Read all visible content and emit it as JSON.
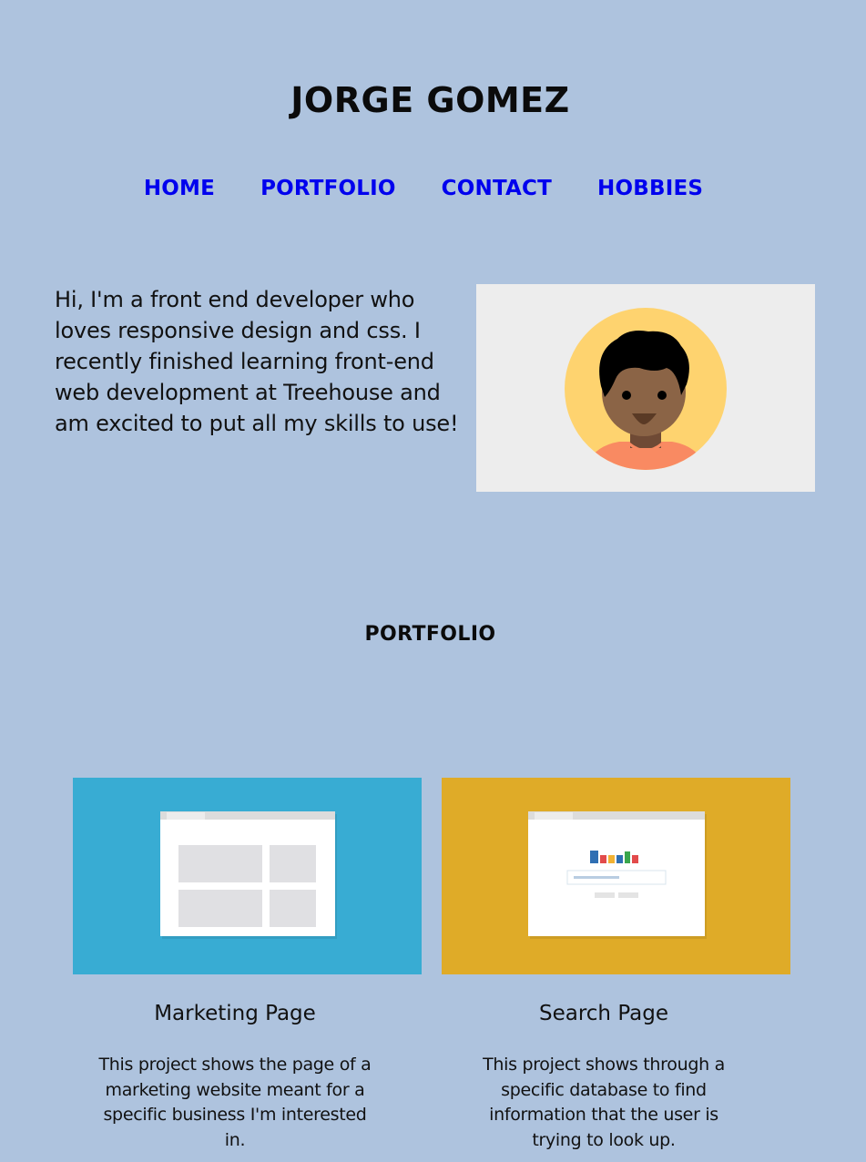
{
  "header": {
    "title": "JORGE GOMEZ"
  },
  "nav": {
    "items": [
      {
        "label": "HOME"
      },
      {
        "label": "PORTFOLIO"
      },
      {
        "label": "CONTACT"
      },
      {
        "label": "HOBBIES"
      }
    ]
  },
  "intro": {
    "text": "Hi, I'm a front end developer who loves responsive design and css. I recently finished learning front-end web development at Treehouse and am excited to put all my skills to use!"
  },
  "portfolio": {
    "heading": "PORTFOLIO",
    "projects": [
      {
        "title": "Marketing Page",
        "description": "This project shows the page of a marketing website meant for a specific business I'm interested in.",
        "color": "#38acd3"
      },
      {
        "title": "Search Page",
        "description": "This project shows through a specific database to find information that the user is trying to look up.",
        "color": "#dfab28"
      }
    ]
  },
  "colors": {
    "background": "#aec3de",
    "link": "#0000ee"
  }
}
